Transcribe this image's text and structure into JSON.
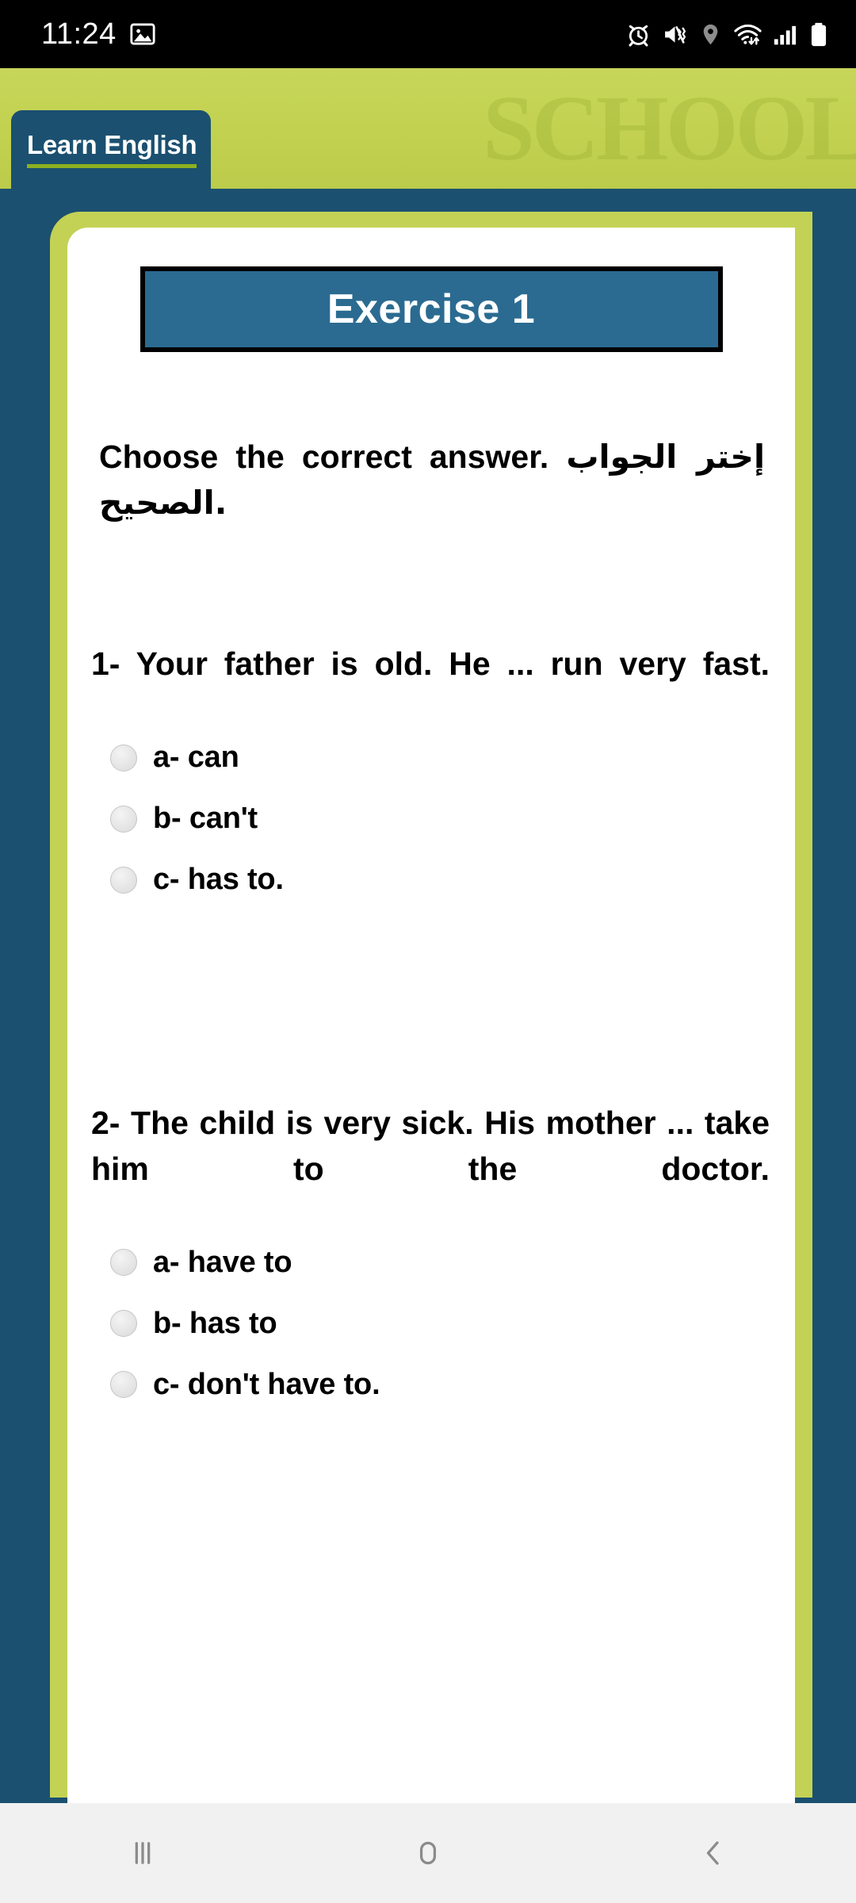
{
  "status_bar": {
    "time": "11:24",
    "left_icons": [
      {
        "name": "image-icon",
        "glyph": "picture"
      }
    ],
    "right_icons": [
      {
        "name": "alarm-icon",
        "glyph": "alarm clock"
      },
      {
        "name": "vibrate-mute-icon",
        "glyph": "speaker muted with vibration"
      },
      {
        "name": "location-icon",
        "glyph": "location pin"
      },
      {
        "name": "wifi-icon",
        "glyph": "wifi with up/down arrows"
      },
      {
        "name": "cellular-signal-icon",
        "glyph": "signal bars"
      },
      {
        "name": "battery-icon",
        "glyph": "battery full"
      }
    ]
  },
  "header": {
    "brand_label": "Learn English",
    "watermark_text": "SCHOOL"
  },
  "card": {
    "exercise_title": "Exercise 1",
    "instruction_en": "Choose the correct answer.",
    "instruction_ar": "إختر الجواب الصحيح.",
    "questions": [
      {
        "number": "1-",
        "text": "1-  Your  father  is  old.  He  ...  run very fast.",
        "options": [
          {
            "label": "a- can",
            "selected": false
          },
          {
            "label": "b- can't",
            "selected": false
          },
          {
            "label": "c- has to.",
            "selected": false
          }
        ]
      },
      {
        "number": "2-",
        "text": "2-  The  child  is  very  sick.  His mother ... take him to the doctor.",
        "options": [
          {
            "label": "a- have to",
            "selected": false
          },
          {
            "label": "b- has to",
            "selected": false
          },
          {
            "label": "c- don't have to.",
            "selected": false
          }
        ]
      }
    ]
  },
  "nav_bar": {
    "buttons": [
      {
        "name": "recents-button",
        "label": "Recents"
      },
      {
        "name": "home-button",
        "label": "Home"
      },
      {
        "name": "back-button",
        "label": "Back"
      }
    ]
  },
  "colors": {
    "status_bar_bg": "#000000",
    "header_green": "#c2d14f",
    "brand_blue": "#1b5070",
    "page_blue": "#1b5070",
    "card_border_green": "#c3d255",
    "title_box_blue": "#2b6b91",
    "card_bg": "#ffffff",
    "nav_bg": "#f1f1f1",
    "text_black": "#000000"
  }
}
